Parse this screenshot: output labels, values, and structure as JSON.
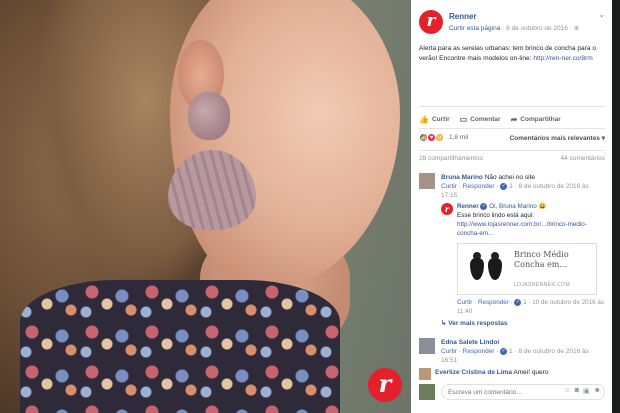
{
  "post": {
    "page_name": "Renner",
    "like_page": "Curtir esta página",
    "date": "· 8 de outubro de 2016 ·",
    "menu_icon": "chevron-down-icon",
    "text": "Alerta para as sereias urbanas: tem brinco de concha para o verão! Encontre mais modelos on-line: ",
    "link": "http://ren-ner.co/8rm"
  },
  "actions": {
    "like": "Curtir",
    "comment": "Comentar",
    "share": "Compartilhar"
  },
  "reactions": {
    "count": "1,8 mil",
    "relevance": "Comentários mais relevantes ▾"
  },
  "counts": {
    "shares": "28 compartilhamentos",
    "comments": "44 comentários"
  },
  "comments": [
    {
      "name": "Bruna Marino",
      "text": " Não achei no site",
      "meta_link": "Curtir · Responder · ",
      "meta_rest": " 3 · 8 de outubro de 2016 às 17:15"
    },
    {
      "name": "Edna Salete Lindoi",
      "text": "",
      "meta_link": "Curtir · Responder · ",
      "meta_rest": " 1 · 8 de outubro de 2016 às 16:51"
    },
    {
      "name": "Everlize Cristina de Lima",
      "text": " Amei! quero",
      "meta_link": "",
      "meta_rest": ""
    }
  ],
  "reply": {
    "name": "Renner",
    "mention": "Oi, Bruna Marino",
    "emoji": "😀",
    "text": "Esse brinco lindo está aqui:",
    "link": "http://www.lojasrenner.com.br/.../brinco-medio-concha-em...",
    "preview_title": "Brinco Médio Concha em...",
    "preview_domain": "LOJASRENNER.COM",
    "meta_link": "Curtir · Responder · ",
    "meta_rest": " 1 · 10 de outubro de 2016 às 11:40"
  },
  "more_replies": "↳ Ver mais respostas",
  "comment_box": {
    "placeholder": "Escreva um comentário..."
  },
  "colors": {
    "brand_red": "#e4202b",
    "facebook_blue": "#365899"
  }
}
